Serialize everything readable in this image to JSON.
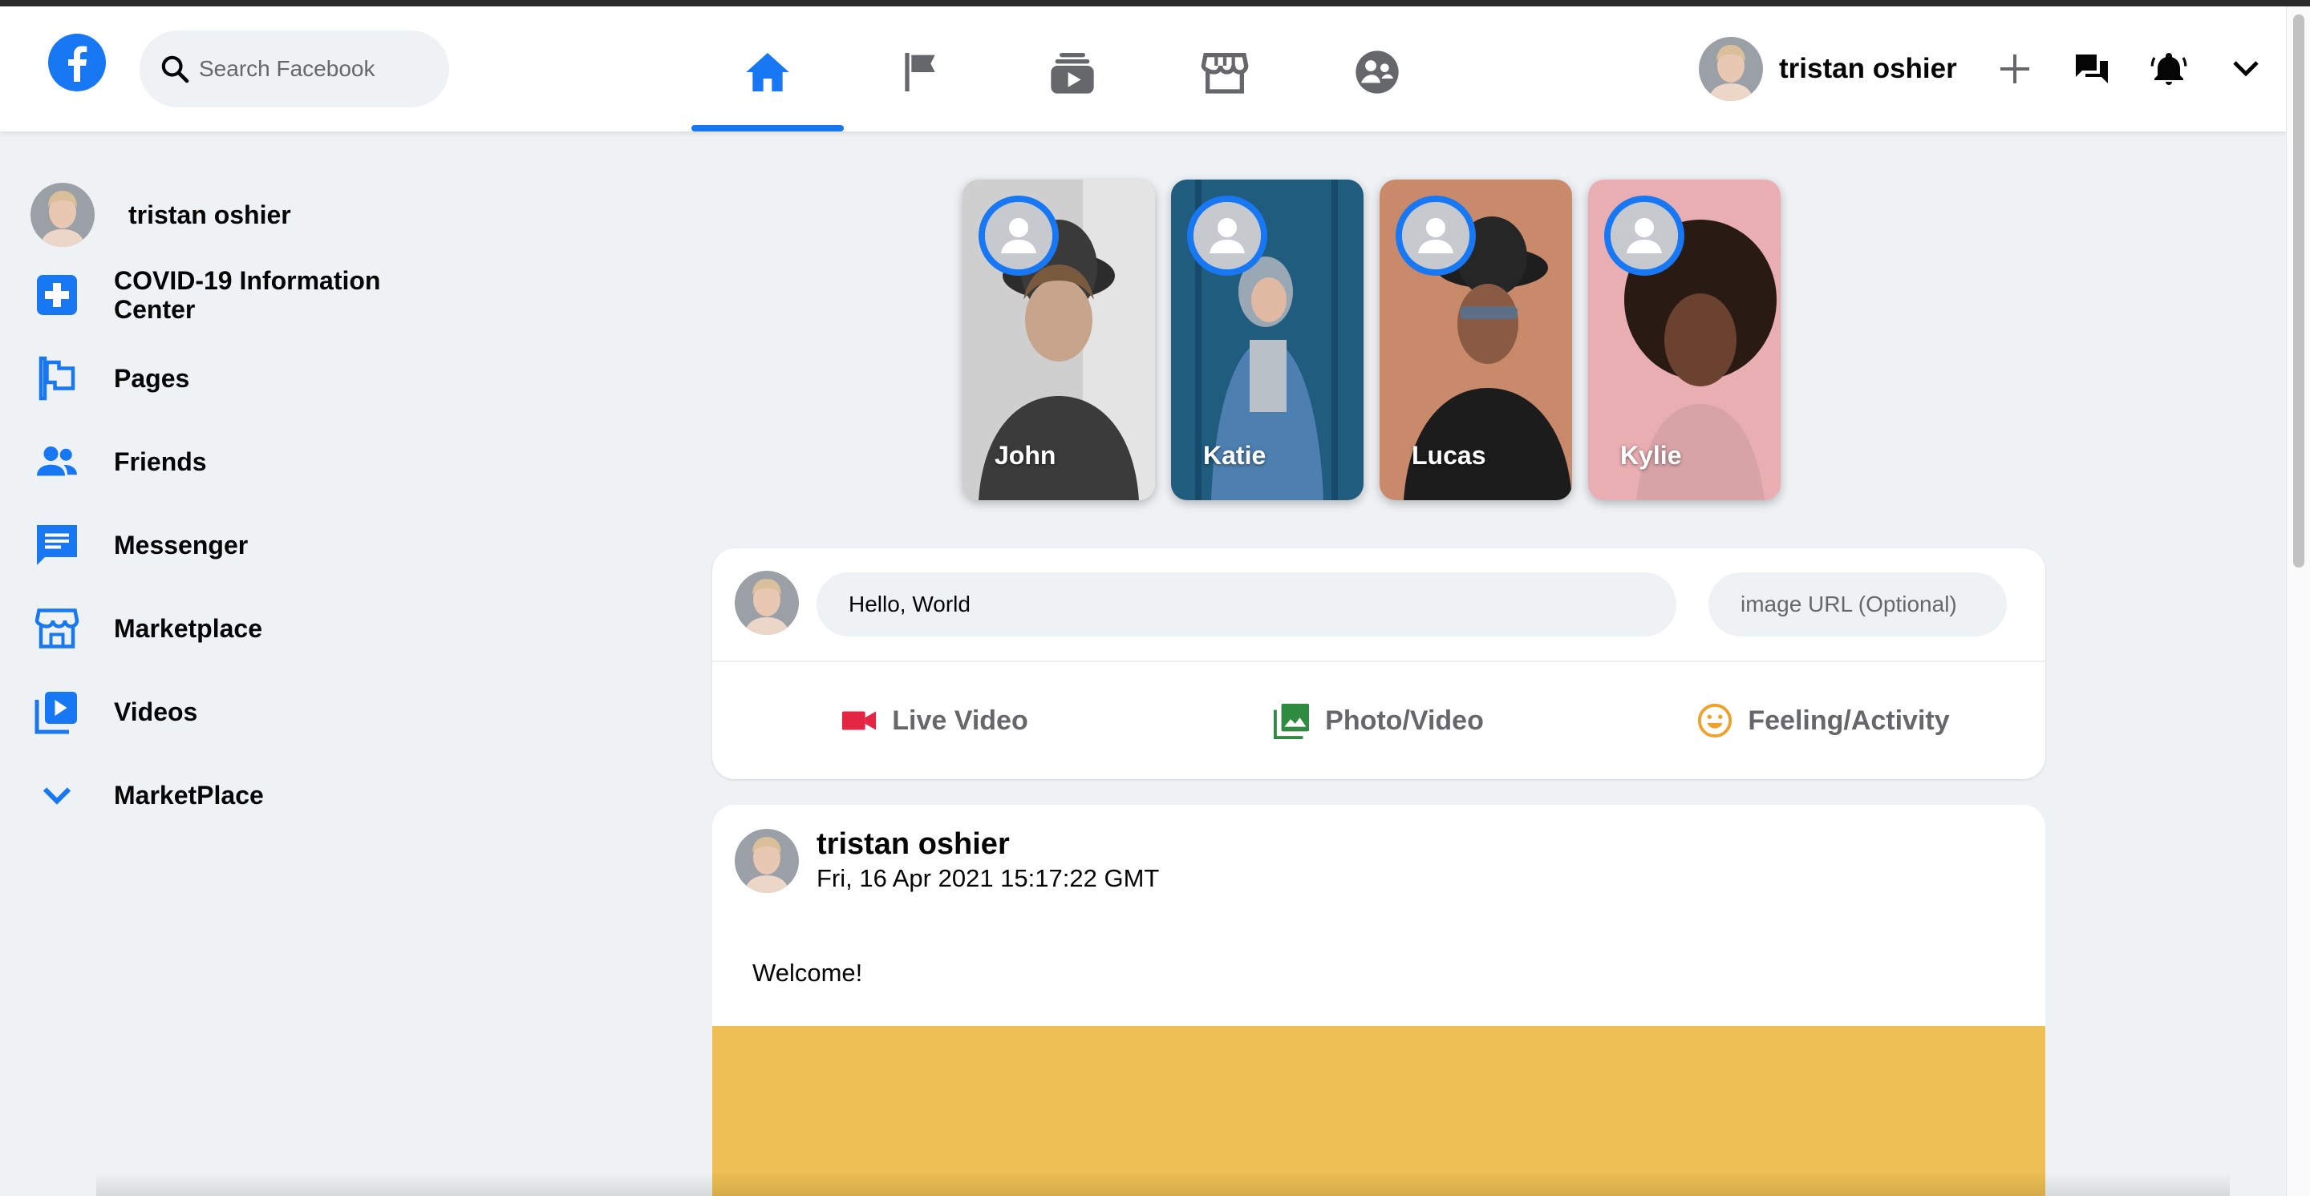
{
  "header": {
    "search_placeholder": "Search Facebook",
    "nav_tabs": [
      {
        "name": "home",
        "icon": "home-icon",
        "active": true
      },
      {
        "name": "pages",
        "icon": "flag-icon",
        "active": false
      },
      {
        "name": "watch",
        "icon": "video-stack-icon",
        "active": false
      },
      {
        "name": "marketplace",
        "icon": "storefront-icon",
        "active": false
      },
      {
        "name": "groups",
        "icon": "groups-icon",
        "active": false
      }
    ],
    "user_name": "tristan oshier",
    "right_icons": [
      "plus-icon",
      "chat-bubbles-icon",
      "bell-icon",
      "chevron-down-icon"
    ]
  },
  "sidebar": {
    "profile_name": "tristan oshier",
    "items": [
      {
        "label": "COVID-19 Information Center",
        "icon": "medical-cross-icon"
      },
      {
        "label": "Pages",
        "icon": "flag-icon"
      },
      {
        "label": "Friends",
        "icon": "people-icon"
      },
      {
        "label": "Messenger",
        "icon": "chat-icon"
      },
      {
        "label": "Marketplace",
        "icon": "storefront-icon"
      },
      {
        "label": "Videos",
        "icon": "video-library-icon"
      },
      {
        "label": "MarketPlace",
        "icon": "chevron-down-icon"
      }
    ]
  },
  "stories": [
    {
      "name": "John"
    },
    {
      "name": "Katie"
    },
    {
      "name": "Lucas"
    },
    {
      "name": "Kylie"
    }
  ],
  "composer": {
    "status_value": "Hello, World",
    "image_url_placeholder": "image URL (Optional)",
    "actions": [
      {
        "label": "Live Video",
        "icon": "video-camera-icon"
      },
      {
        "label": "Photo/Video",
        "icon": "photo-icon"
      },
      {
        "label": "Feeling/Activity",
        "icon": "smiley-icon"
      }
    ]
  },
  "post": {
    "author": "tristan oshier",
    "timestamp": "Fri, 16 Apr 2021 15:17:22 GMT",
    "text": "Welcome!"
  },
  "colors": {
    "brand": "#1877f2",
    "background": "#eff2f5",
    "live_red": "#f02849",
    "photo_green": "#45bd62",
    "feeling_orange": "#f7b928",
    "post_image": "#ecbe53"
  }
}
